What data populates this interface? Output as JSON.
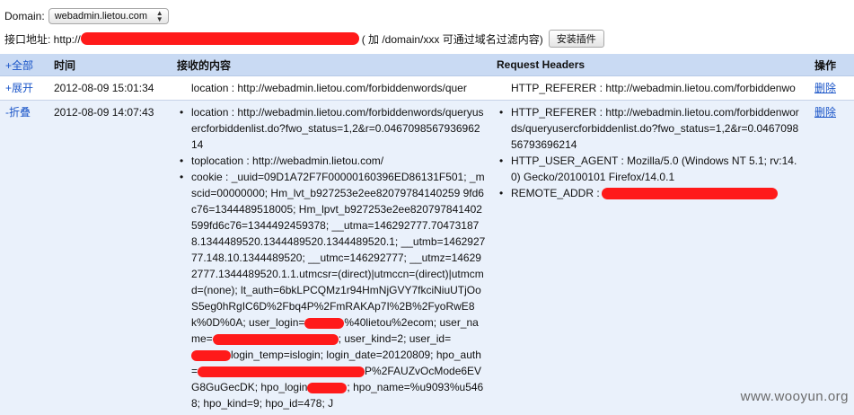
{
  "toolbar": {
    "domain_label": "Domain:",
    "domain_value": "webadmin.lietou.com",
    "api_label": "接口地址: http://",
    "api_hint": "( 加 /domain/xxx 可通过域名过滤内容)",
    "install_button": "安装插件"
  },
  "table": {
    "headers": {
      "toggle_all": "+全部",
      "time": "时间",
      "content": "接收的内容",
      "request_headers": "Request Headers",
      "action": "操作"
    },
    "rows": [
      {
        "toggle": "+展开",
        "time": "2012-08-09 15:01:34",
        "content": [
          "location : http://webadmin.lietou.com/forbiddenwords/quer"
        ],
        "headers": [
          "HTTP_REFERER : http://webadmin.lietou.com/forbiddenwo"
        ],
        "action": "删除"
      },
      {
        "toggle": "-折叠",
        "time": "2012-08-09 14:07:43",
        "content": {
          "location": "location : http://webadmin.lietou.com/forbiddenwords/queryusercforbiddenlist.do?fwo_status=1,2&r=0.046709856793696214",
          "toplocation": "toplocation : http://webadmin.lietou.com/",
          "cookie_part1": "cookie : _uuid=09D1A72F7F00000160396ED86131F501; _mscid=00000000; Hm_lvt_b927253e2ee82079784140259 9fd6c76=1344489518005; Hm_lpvt_b927253e2ee820797841402599fd6c76=1344492459378; __utma=146292777.704731878.1344489520.1344489520.1344489520.1; __utmb=146292777.148.10.1344489520; __utmc=146292777; __utmz=146292777.1344489520.1.1.utmcsr=(direct)|utmccn=(direct)|utmcmd=(none); lt_auth=6bkLPCQMz1r94HmNjGVY7fkciNiuUTjOoS5eg0hRgIC6D%2Fbq4P%2FmRAKAp7I%2B%2FyoRwE8k%0D%0A; user_login=",
          "cookie_part2": "%40lietou%2ecom; user_name=",
          "cookie_part3": "; user_kind=2; user_id=",
          "cookie_part4": "login_temp=islogin; login_date=20120809; hpo_auth=",
          "cookie_part5": "P%2FAUZvOcMode6EVG8GuGecDK; hpo_login",
          "cookie_part6": "; hpo_name=%u9093%u5468; hpo_kind=9; hpo_id=478; J"
        },
        "headers": {
          "referer": "HTTP_REFERER : http://webadmin.lietou.com/forbiddenwords/queryusercforbiddenlist.do?fwo_status=1,2&r=0.046709856793696214",
          "user_agent": "HTTP_USER_AGENT : Mozilla/5.0 (Windows NT 5.1; rv:14.0) Gecko/20100101 Firefox/14.0.1",
          "remote_addr": "REMOTE_ADDR :"
        },
        "action": "删除"
      }
    ]
  },
  "watermark": "www.wooyun.org",
  "colors": {
    "header_bg": "#c9daf3",
    "link": "#1a55c8",
    "redaction": "#ff1a1a",
    "row_bg": "#eaf1fb"
  }
}
